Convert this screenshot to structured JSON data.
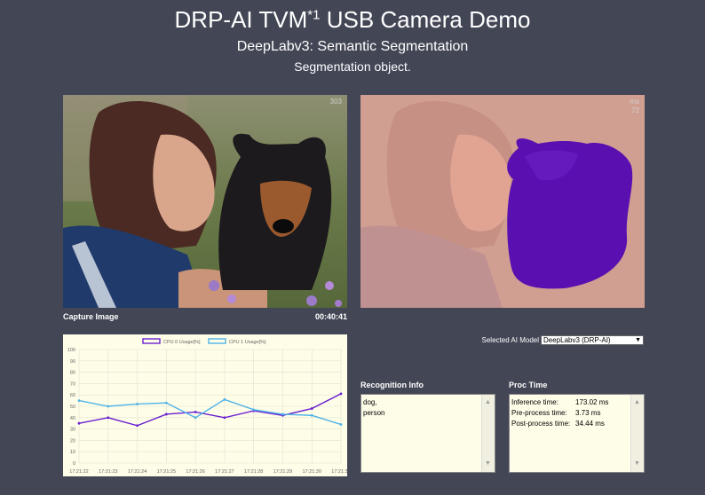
{
  "header": {
    "title": "DRP-AI TVM",
    "title_sup": "*1",
    "title_suffix": " USB Camera Demo",
    "subtitle": "DeepLabv3: Semantic Segmentation",
    "subtitle2": "Segmentation object."
  },
  "capture": {
    "label": "Capture Image",
    "time": "00:40:41",
    "corner_text": "303"
  },
  "segmentation": {
    "corner_text_1": "ms",
    "corner_text_2": "72"
  },
  "model": {
    "label": "Selected AI Model",
    "selected": "DeepLabv3 (DRP-AI)"
  },
  "recognition": {
    "title": "Recognition Info",
    "lines": [
      "dog,",
      "person"
    ]
  },
  "proc_time": {
    "title": "Proc Time",
    "rows": [
      {
        "key": "Inference time:",
        "value": "173.02 ms"
      },
      {
        "key": "Pre-process time:",
        "value": "3.73 ms"
      },
      {
        "key": "Post-process time:",
        "value": "34.44 ms"
      }
    ]
  },
  "colors": {
    "background": "#434655",
    "cpu0": "#6a1fd1",
    "cpu1": "#4fb3e8",
    "segmentation_overlay": "#e7a49a",
    "dog_mask": "#5a0fb0"
  },
  "chart_data": {
    "type": "line",
    "x": [
      "17:21:22",
      "17:21:23",
      "17:21:24",
      "17:21:25",
      "17:21:26",
      "17:21:27",
      "17:21:28",
      "17:21:29",
      "17:21:30",
      "17:21:31"
    ],
    "series": [
      {
        "name": "CPU 0 Usage[%]",
        "values": [
          35,
          40,
          33,
          43,
          45,
          40,
          46,
          42,
          48,
          61
        ]
      },
      {
        "name": "CPU 1 Usage[%]",
        "values": [
          55,
          50,
          52,
          53,
          40,
          56,
          47,
          43,
          42,
          34
        ]
      }
    ],
    "ylim": [
      0,
      100
    ],
    "yticks": [
      0,
      10,
      20,
      30,
      40,
      50,
      60,
      70,
      80,
      90,
      100
    ],
    "legend": "top",
    "grid": true
  }
}
